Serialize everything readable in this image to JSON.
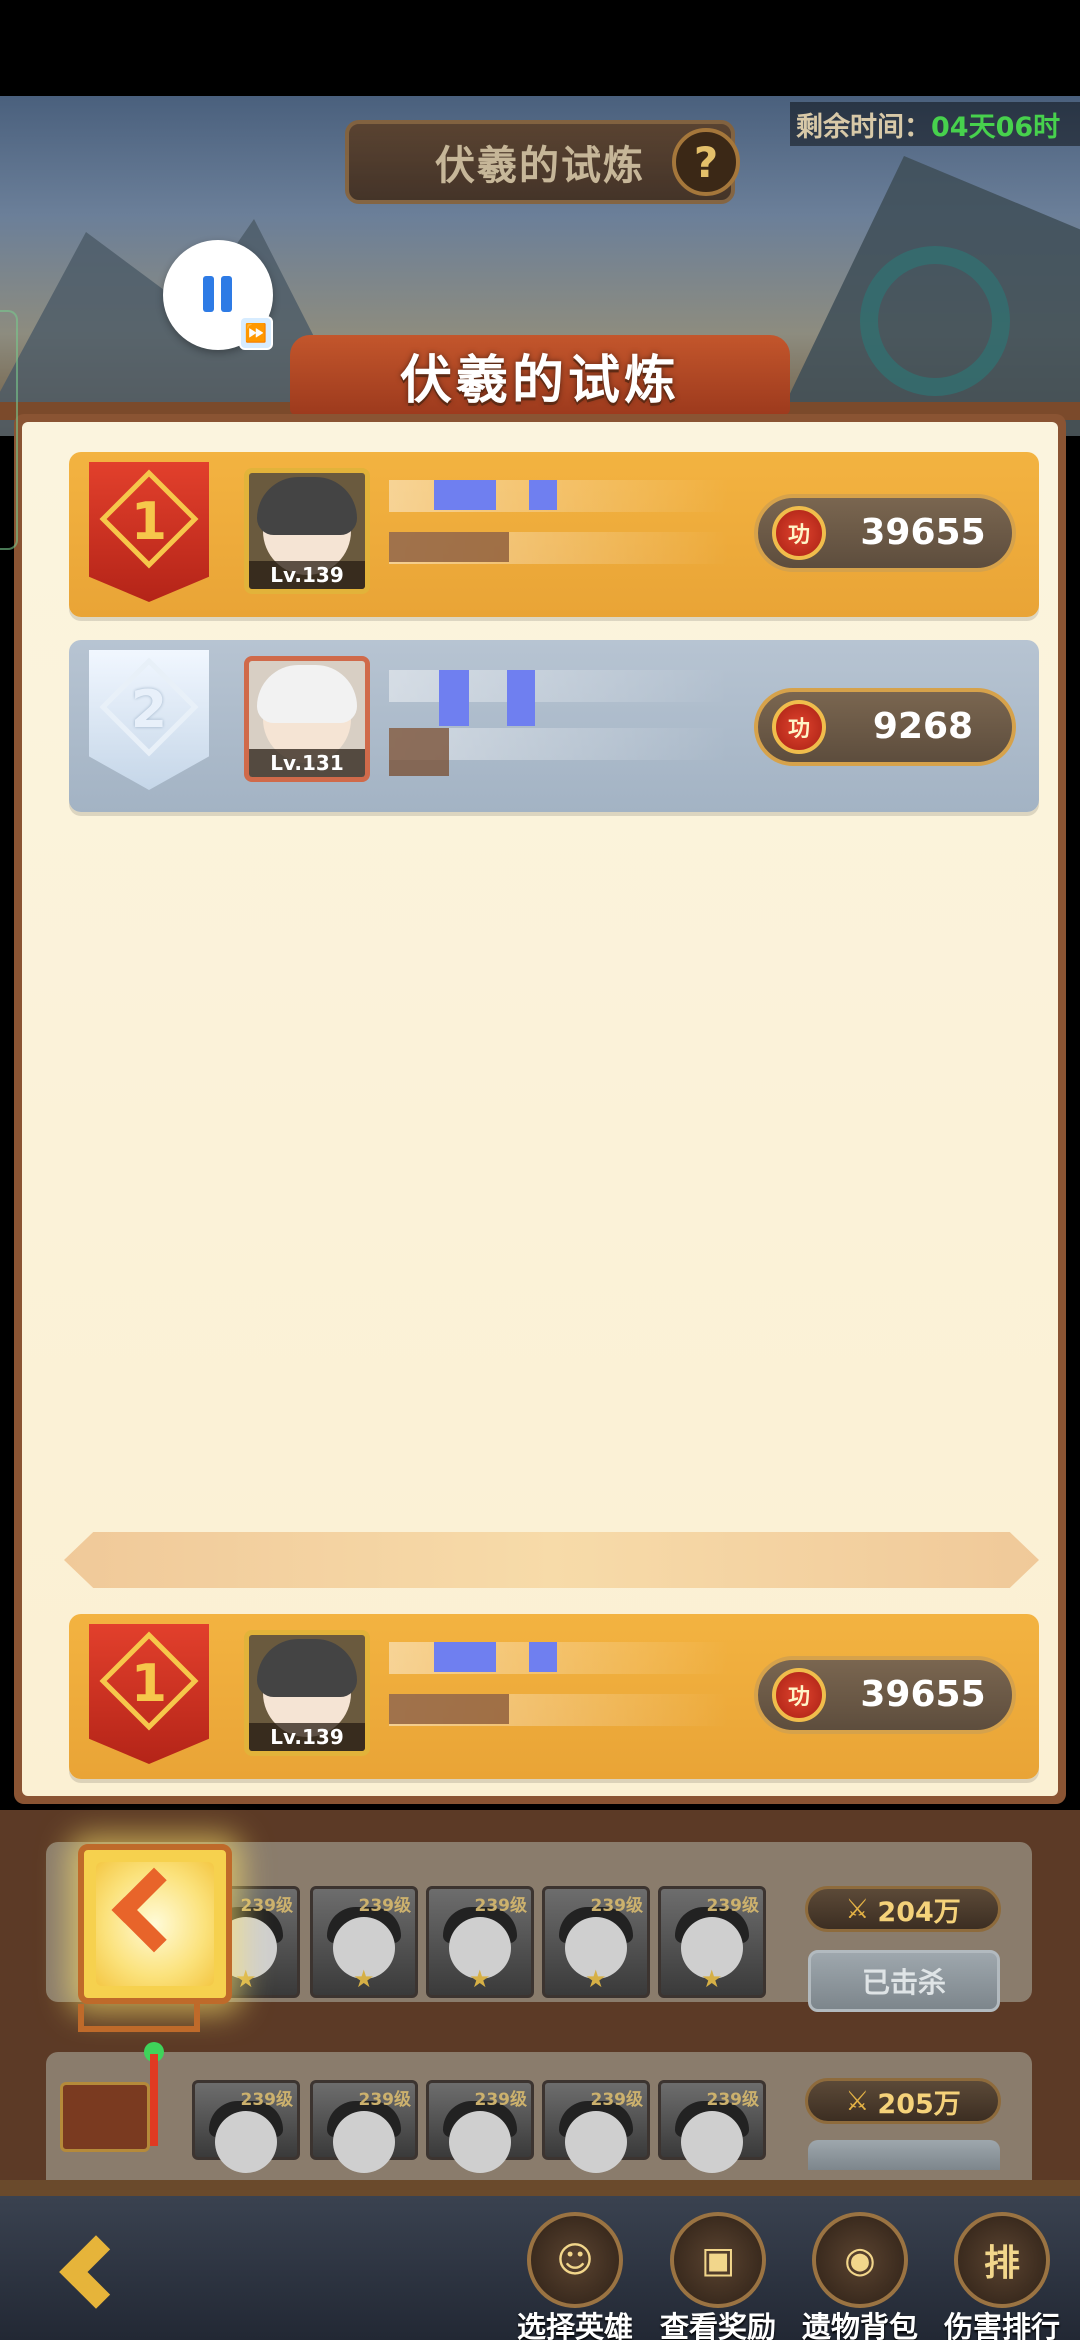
{
  "header": {
    "plaque_title": "伏羲的试炼",
    "help_symbol": "?",
    "timer_label": "剩余时间：",
    "timer_value": "04天06时"
  },
  "banner": {
    "title": "伏羲的试炼"
  },
  "player_controls": {
    "fast_forward_symbol": "⏩"
  },
  "leaderboard": {
    "rows": [
      {
        "rank": "1",
        "level": "Lv.139",
        "score_icon": "功",
        "score": "39655"
      },
      {
        "rank": "2",
        "level": "Lv.131",
        "score_icon": "功",
        "score": "9268"
      }
    ],
    "my_rank": {
      "rank": "1",
      "level": "Lv.139",
      "score_icon": "功",
      "score": "39655"
    }
  },
  "waves": [
    {
      "hero_levels": [
        "239级",
        "239级",
        "239级",
        "239级",
        "239级"
      ],
      "power": "204万",
      "status_button": "已击杀"
    },
    {
      "hero_levels": [
        "239级",
        "239级",
        "239级",
        "239级",
        "239级"
      ],
      "power": "205万"
    }
  ],
  "bottom_nav": {
    "items": [
      {
        "label": "选择英雄",
        "icon": "hero-icon",
        "glyph": "☺"
      },
      {
        "label": "查看奖励",
        "icon": "treasure-chest-icon",
        "glyph": "▣"
      },
      {
        "label": "遗物背包",
        "icon": "bag-icon",
        "glyph": "◉"
      },
      {
        "label": "伤害排行",
        "icon": "ranking-scroll-icon",
        "glyph": "排"
      }
    ]
  },
  "colors": {
    "gold_row": "#f3b341",
    "silver_row": "#b7c4d2",
    "timer_value": "#47d14d",
    "panel_bg": "#fbf4de"
  }
}
